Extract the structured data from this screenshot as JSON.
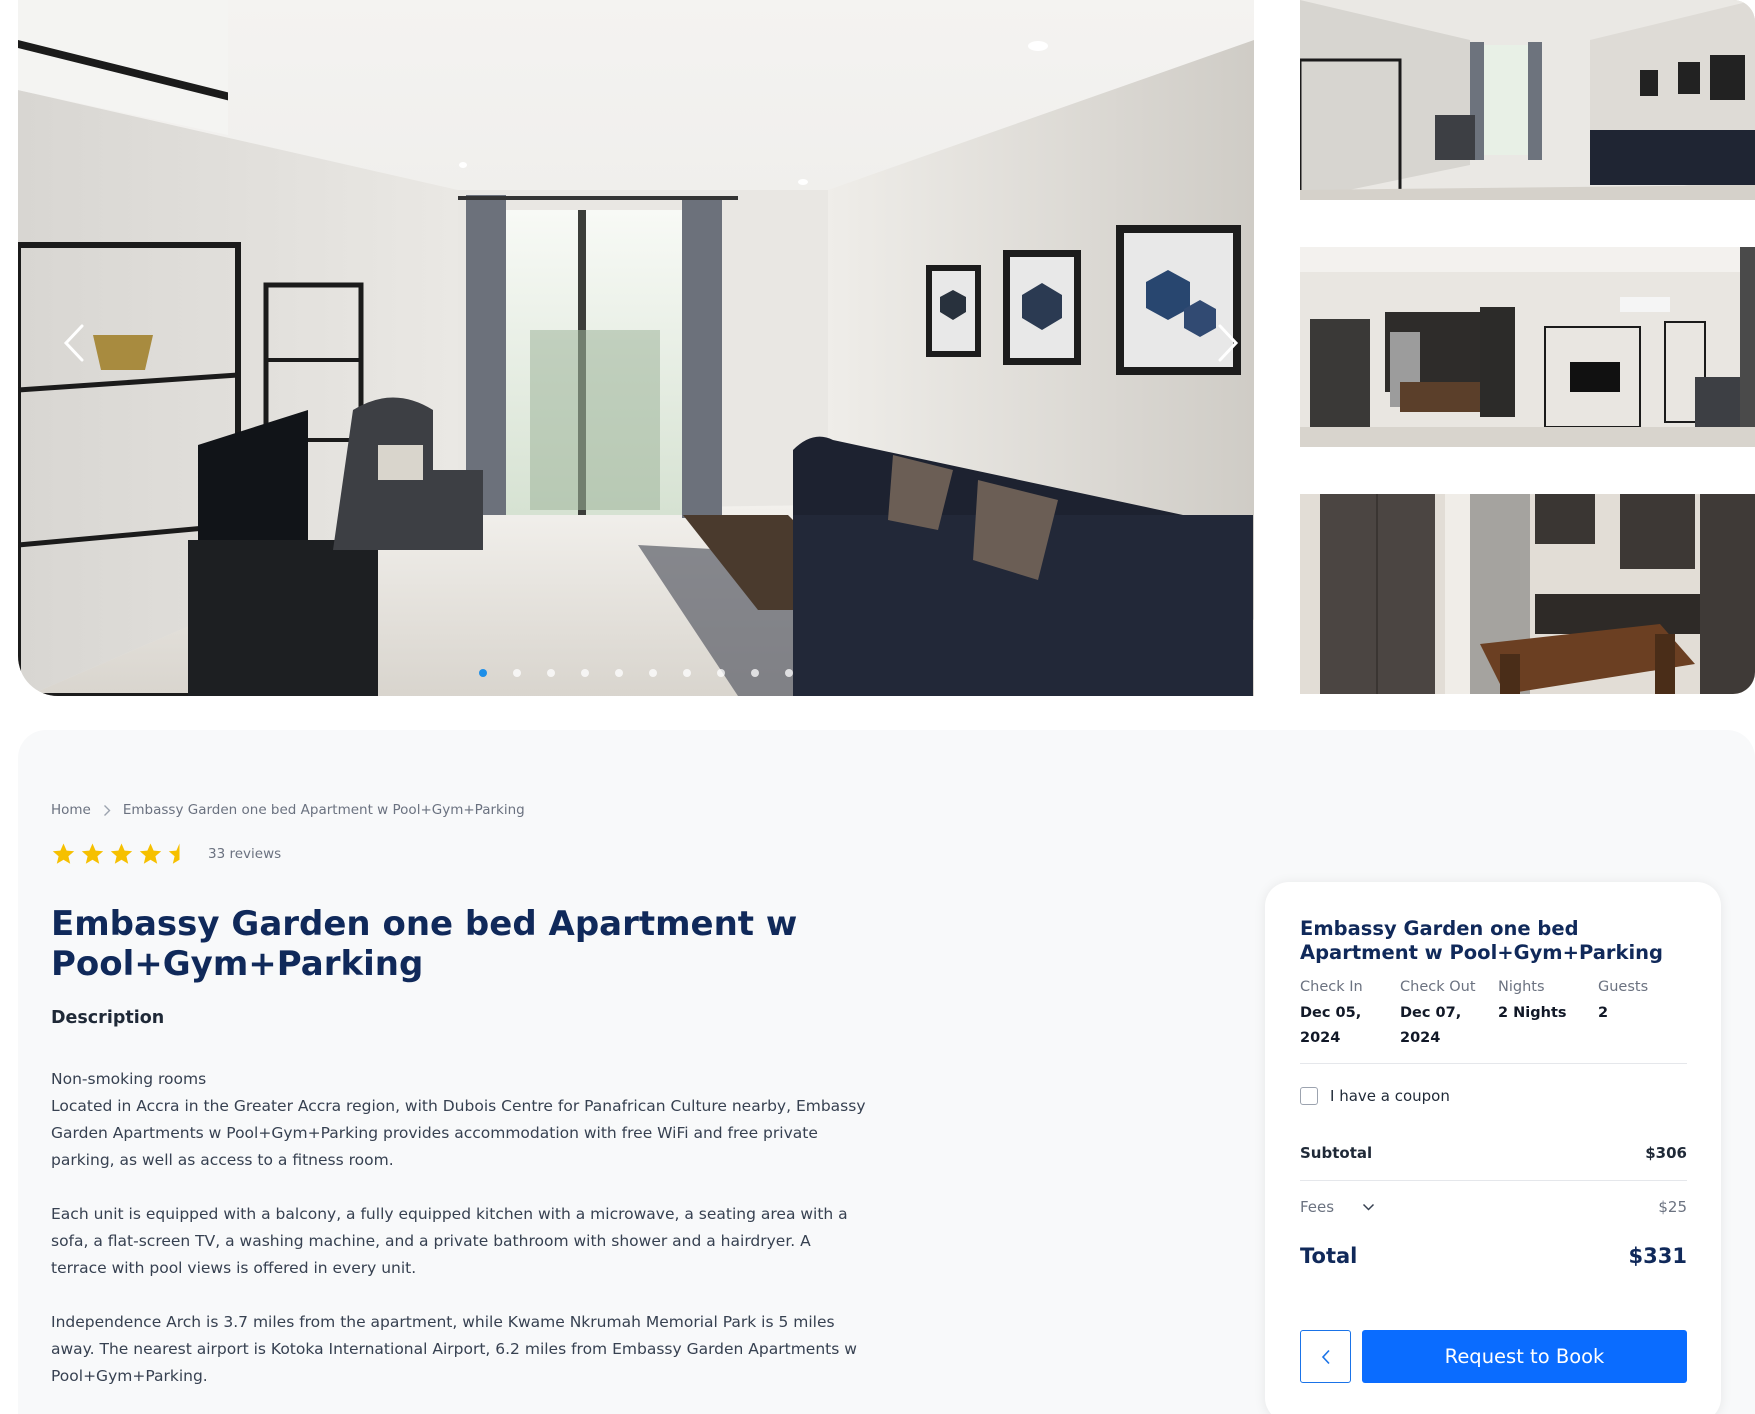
{
  "gallery": {
    "main_image_alt": "Living room with dark sofa, glass shelving, TV and balcony doors",
    "thumbnails": [
      {
        "alt": "Living room wide view"
      },
      {
        "alt": "Living room with kitchen and entrance door"
      },
      {
        "alt": "Kitchen with dining table"
      }
    ],
    "slide_count": 10,
    "active_slide": 0,
    "accent_color": "#1e8fe8"
  },
  "breadcrumb": {
    "home": "Home",
    "current": "Embassy Garden one bed Apartment w Pool+Gym+Parking"
  },
  "rating": {
    "stars": 4.5,
    "reviews": "33 reviews",
    "star_color": "#f6c000"
  },
  "listing": {
    "title": "Embassy Garden one bed Apartment w Pool+Gym+Parking",
    "description_heading": "Description",
    "description": [
      [
        "Non-smoking rooms",
        "Located in Accra in the Greater Accra region, with Dubois Centre for Panafrican Culture nearby, Embassy Garden Apartments w Pool+Gym+Parking provides accommodation with free WiFi and free private parking, as well as access to a fitness room."
      ],
      [
        "Each unit is equipped with a balcony, a fully equipped kitchen with a microwave, a seating area with a sofa, a flat-screen TV, a washing machine, and a private bathroom with shower and a hairdryer. A terrace with pool views is offered in every unit."
      ],
      [
        "Independence Arch is 3.7 miles from the apartment, while Kwame Nkrumah Memorial Park is 5 miles away. The nearest airport is Kotoka International Airport, 6.2 miles from Embassy Garden Apartments w Pool+Gym+Parking."
      ]
    ]
  },
  "booking": {
    "title": "Embassy Garden one bed Apartment w Pool+Gym+Parking",
    "check_in_label": "Check In",
    "check_in_line1": "Dec 05,",
    "check_in_line2": "2024",
    "check_out_label": "Check Out",
    "check_out_line1": "Dec 07,",
    "check_out_line2": "2024",
    "nights_label": "Nights",
    "nights_value": "2 Nights",
    "guests_label": "Guests",
    "guests_value": "2",
    "coupon_label": "I have a coupon",
    "subtotal_label": "Subtotal",
    "subtotal_value": "$306",
    "fees_label": "Fees",
    "fees_value": "$25",
    "total_label": "Total",
    "total_value": "$331",
    "request_button": "Request to Book",
    "primary_color": "#0a6cff",
    "title_color": "#10295a"
  }
}
